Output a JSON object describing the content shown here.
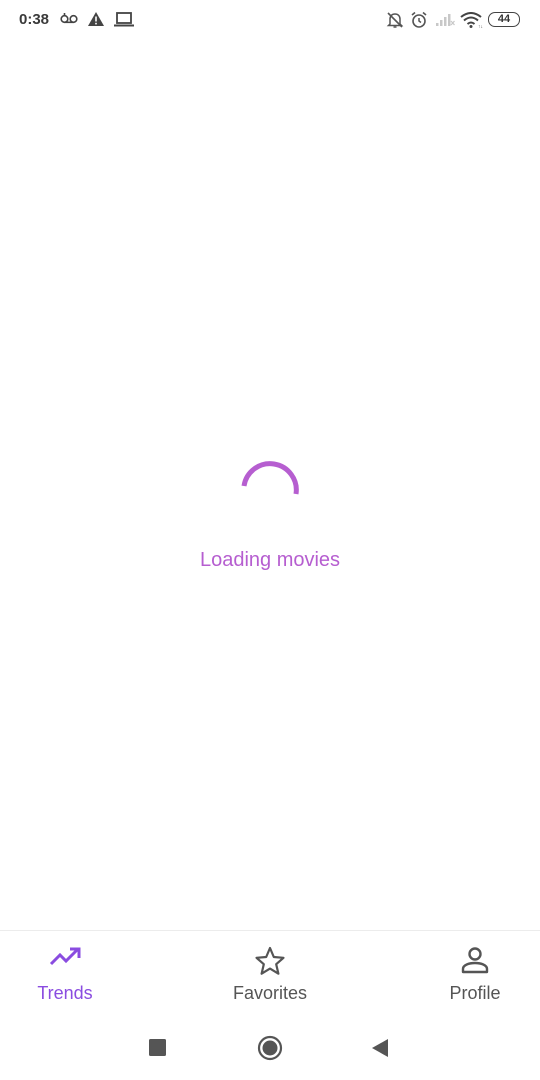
{
  "status_bar": {
    "time": "0:38",
    "battery": "44",
    "icons": [
      "voicemail-icon",
      "warning-icon",
      "laptop-icon",
      "notifications-off-icon",
      "alarm-icon",
      "signal-icon",
      "wifi-icon",
      "battery-icon"
    ]
  },
  "main": {
    "loading_text": "Loading movies",
    "accent_color": "#b65ed0"
  },
  "bottom_nav": {
    "items": [
      {
        "label": "Trends",
        "icon": "trending-up-icon",
        "active": true
      },
      {
        "label": "Favorites",
        "icon": "star-outline-icon",
        "active": false
      },
      {
        "label": "Profile",
        "icon": "person-outline-icon",
        "active": false
      }
    ],
    "active_color": "#8a4ce0"
  },
  "system_nav": {
    "buttons": [
      "recents-square-icon",
      "home-circle-icon",
      "back-triangle-icon"
    ]
  }
}
